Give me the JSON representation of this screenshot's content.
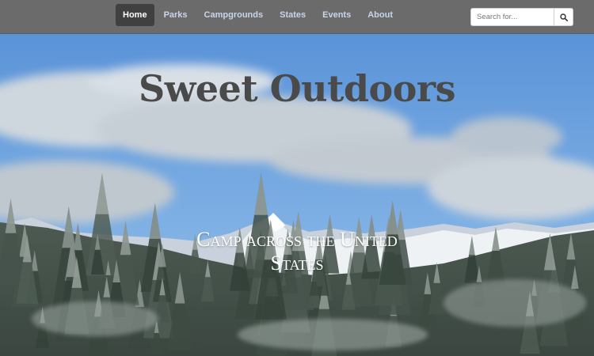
{
  "nav": {
    "items": [
      {
        "label": "Home",
        "active": true
      },
      {
        "label": "Parks"
      },
      {
        "label": "Campgrounds"
      },
      {
        "label": "States"
      },
      {
        "label": "Events"
      },
      {
        "label": "About"
      }
    ]
  },
  "search": {
    "placeholder": "Search for...",
    "button_icon": "search-icon"
  },
  "hero": {
    "title": "Sweet Outdoors",
    "subtitle": "Camp across the United States",
    "background": "snowy mountain and pine forest under blue sky with clouds"
  },
  "colors": {
    "navbar": "#6b6b6b",
    "nav_active": "#404040",
    "nav_link": "#c9d6ea",
    "title": "#4a4a4a",
    "sky": "#5f96d6"
  }
}
